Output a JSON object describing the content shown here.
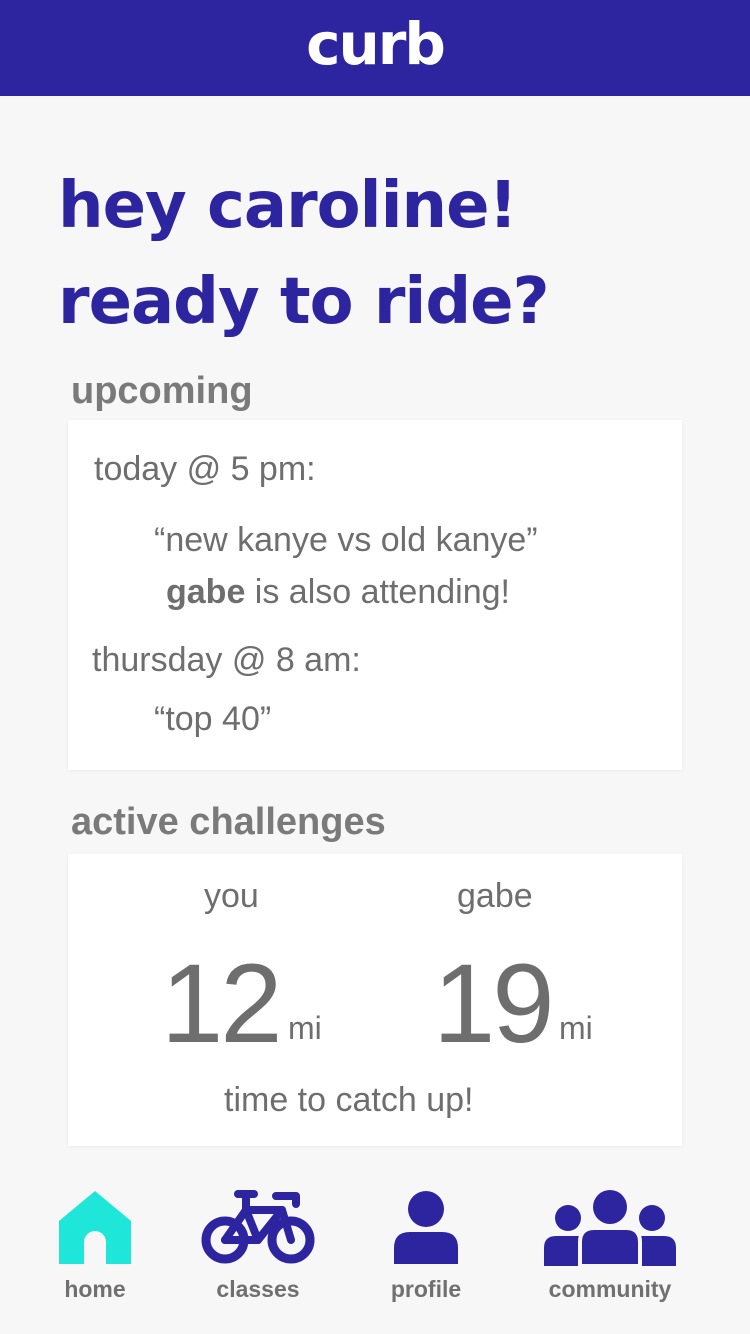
{
  "app": {
    "logo": "curb"
  },
  "greeting": "hey caroline! ready to ride?",
  "upcoming": {
    "title": "upcoming",
    "entries": [
      {
        "when": "today @ 5 pm:",
        "class_name": "“new kanye vs old kanye”",
        "friend": "gabe",
        "friend_note": " is also attending!"
      },
      {
        "when": "thursday @ 8 am:",
        "class_name": "“top 40”"
      }
    ]
  },
  "challenges": {
    "title": "active challenges",
    "players": [
      {
        "name": "you",
        "distance": "12",
        "unit": "mi"
      },
      {
        "name": "gabe",
        "distance": "19",
        "unit": "mi"
      }
    ],
    "message": "time to catch up!"
  },
  "nav": {
    "items": [
      {
        "label": "home",
        "icon": "home-icon",
        "active": true
      },
      {
        "label": "classes",
        "icon": "bicycle-icon",
        "active": false
      },
      {
        "label": "profile",
        "icon": "person-icon",
        "active": false
      },
      {
        "label": "community",
        "icon": "group-icon",
        "active": false
      }
    ]
  },
  "colors": {
    "brand": "#2d24a0",
    "active_nav": "#1ee6d8",
    "text_gray": "#6e6e6e",
    "background": "#f7f7f7"
  }
}
